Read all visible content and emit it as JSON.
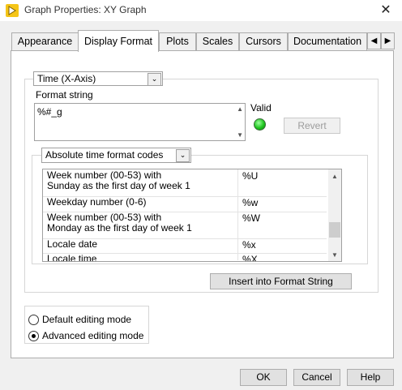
{
  "window": {
    "title": "Graph Properties: XY Graph",
    "close_glyph": "✕"
  },
  "tabs": [
    {
      "label": "Appearance",
      "active": false
    },
    {
      "label": "Display Format",
      "active": true
    },
    {
      "label": "Plots",
      "active": false
    },
    {
      "label": "Scales",
      "active": false
    },
    {
      "label": "Cursors",
      "active": false
    },
    {
      "label": "Documentation",
      "active": false
    }
  ],
  "tab_scroll": {
    "left": "◀",
    "right": "▶"
  },
  "axis_select": {
    "value": "Time (X-Axis)",
    "arrow": "⌄"
  },
  "format_string": {
    "label": "Format string",
    "value": "%#_g"
  },
  "valid": {
    "label": "Valid",
    "led_color": "#1ec51e"
  },
  "revert_label": "Revert",
  "codes_select": {
    "value": "Absolute time format codes",
    "arrow": "⌄"
  },
  "codes": [
    {
      "description": "Week number (00-53) with\nSunday as the first day of week 1",
      "code": "%U"
    },
    {
      "description": "Weekday number (0-6)",
      "code": "%w"
    },
    {
      "description": "Week number (00-53) with\nMonday as the first day of week 1",
      "code": "%W"
    },
    {
      "description": "Locale date",
      "code": "%x"
    },
    {
      "description": "Locale time",
      "code": "%X"
    }
  ],
  "insert_label": "Insert into Format String",
  "editing_mode": {
    "options": [
      "Default editing mode",
      "Advanced editing mode"
    ],
    "selected": "Advanced editing mode"
  },
  "buttons": {
    "ok": "OK",
    "cancel": "Cancel",
    "help": "Help"
  }
}
